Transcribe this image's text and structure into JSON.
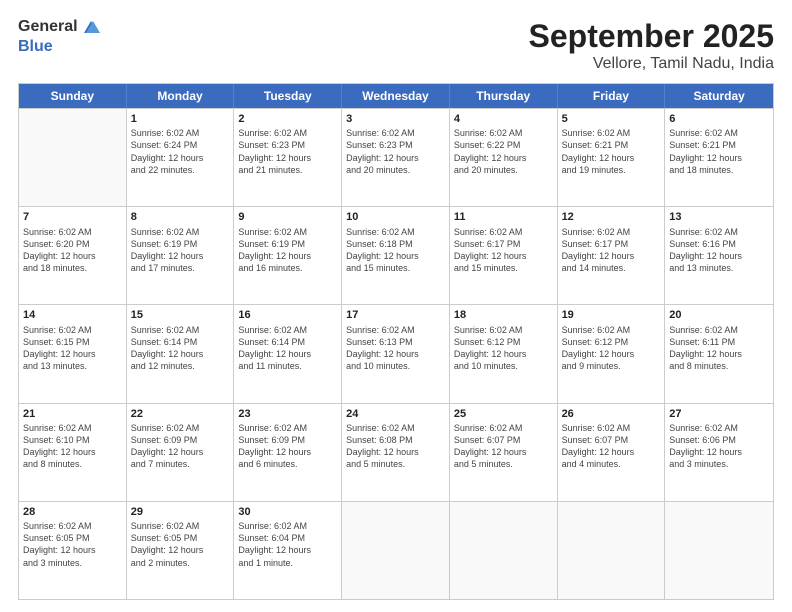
{
  "header": {
    "logo_general": "General",
    "logo_blue": "Blue",
    "title": "September 2025",
    "location": "Vellore, Tamil Nadu, India"
  },
  "weekdays": [
    "Sunday",
    "Monday",
    "Tuesday",
    "Wednesday",
    "Thursday",
    "Friday",
    "Saturday"
  ],
  "weeks": [
    [
      {
        "day": "",
        "info": ""
      },
      {
        "day": "1",
        "info": "Sunrise: 6:02 AM\nSunset: 6:24 PM\nDaylight: 12 hours\nand 22 minutes."
      },
      {
        "day": "2",
        "info": "Sunrise: 6:02 AM\nSunset: 6:23 PM\nDaylight: 12 hours\nand 21 minutes."
      },
      {
        "day": "3",
        "info": "Sunrise: 6:02 AM\nSunset: 6:23 PM\nDaylight: 12 hours\nand 20 minutes."
      },
      {
        "day": "4",
        "info": "Sunrise: 6:02 AM\nSunset: 6:22 PM\nDaylight: 12 hours\nand 20 minutes."
      },
      {
        "day": "5",
        "info": "Sunrise: 6:02 AM\nSunset: 6:21 PM\nDaylight: 12 hours\nand 19 minutes."
      },
      {
        "day": "6",
        "info": "Sunrise: 6:02 AM\nSunset: 6:21 PM\nDaylight: 12 hours\nand 18 minutes."
      }
    ],
    [
      {
        "day": "7",
        "info": "Sunrise: 6:02 AM\nSunset: 6:20 PM\nDaylight: 12 hours\nand 18 minutes."
      },
      {
        "day": "8",
        "info": "Sunrise: 6:02 AM\nSunset: 6:19 PM\nDaylight: 12 hours\nand 17 minutes."
      },
      {
        "day": "9",
        "info": "Sunrise: 6:02 AM\nSunset: 6:19 PM\nDaylight: 12 hours\nand 16 minutes."
      },
      {
        "day": "10",
        "info": "Sunrise: 6:02 AM\nSunset: 6:18 PM\nDaylight: 12 hours\nand 15 minutes."
      },
      {
        "day": "11",
        "info": "Sunrise: 6:02 AM\nSunset: 6:17 PM\nDaylight: 12 hours\nand 15 minutes."
      },
      {
        "day": "12",
        "info": "Sunrise: 6:02 AM\nSunset: 6:17 PM\nDaylight: 12 hours\nand 14 minutes."
      },
      {
        "day": "13",
        "info": "Sunrise: 6:02 AM\nSunset: 6:16 PM\nDaylight: 12 hours\nand 13 minutes."
      }
    ],
    [
      {
        "day": "14",
        "info": "Sunrise: 6:02 AM\nSunset: 6:15 PM\nDaylight: 12 hours\nand 13 minutes."
      },
      {
        "day": "15",
        "info": "Sunrise: 6:02 AM\nSunset: 6:14 PM\nDaylight: 12 hours\nand 12 minutes."
      },
      {
        "day": "16",
        "info": "Sunrise: 6:02 AM\nSunset: 6:14 PM\nDaylight: 12 hours\nand 11 minutes."
      },
      {
        "day": "17",
        "info": "Sunrise: 6:02 AM\nSunset: 6:13 PM\nDaylight: 12 hours\nand 10 minutes."
      },
      {
        "day": "18",
        "info": "Sunrise: 6:02 AM\nSunset: 6:12 PM\nDaylight: 12 hours\nand 10 minutes."
      },
      {
        "day": "19",
        "info": "Sunrise: 6:02 AM\nSunset: 6:12 PM\nDaylight: 12 hours\nand 9 minutes."
      },
      {
        "day": "20",
        "info": "Sunrise: 6:02 AM\nSunset: 6:11 PM\nDaylight: 12 hours\nand 8 minutes."
      }
    ],
    [
      {
        "day": "21",
        "info": "Sunrise: 6:02 AM\nSunset: 6:10 PM\nDaylight: 12 hours\nand 8 minutes."
      },
      {
        "day": "22",
        "info": "Sunrise: 6:02 AM\nSunset: 6:09 PM\nDaylight: 12 hours\nand 7 minutes."
      },
      {
        "day": "23",
        "info": "Sunrise: 6:02 AM\nSunset: 6:09 PM\nDaylight: 12 hours\nand 6 minutes."
      },
      {
        "day": "24",
        "info": "Sunrise: 6:02 AM\nSunset: 6:08 PM\nDaylight: 12 hours\nand 5 minutes."
      },
      {
        "day": "25",
        "info": "Sunrise: 6:02 AM\nSunset: 6:07 PM\nDaylight: 12 hours\nand 5 minutes."
      },
      {
        "day": "26",
        "info": "Sunrise: 6:02 AM\nSunset: 6:07 PM\nDaylight: 12 hours\nand 4 minutes."
      },
      {
        "day": "27",
        "info": "Sunrise: 6:02 AM\nSunset: 6:06 PM\nDaylight: 12 hours\nand 3 minutes."
      }
    ],
    [
      {
        "day": "28",
        "info": "Sunrise: 6:02 AM\nSunset: 6:05 PM\nDaylight: 12 hours\nand 3 minutes."
      },
      {
        "day": "29",
        "info": "Sunrise: 6:02 AM\nSunset: 6:05 PM\nDaylight: 12 hours\nand 2 minutes."
      },
      {
        "day": "30",
        "info": "Sunrise: 6:02 AM\nSunset: 6:04 PM\nDaylight: 12 hours\nand 1 minute."
      },
      {
        "day": "",
        "info": ""
      },
      {
        "day": "",
        "info": ""
      },
      {
        "day": "",
        "info": ""
      },
      {
        "day": "",
        "info": ""
      }
    ]
  ]
}
